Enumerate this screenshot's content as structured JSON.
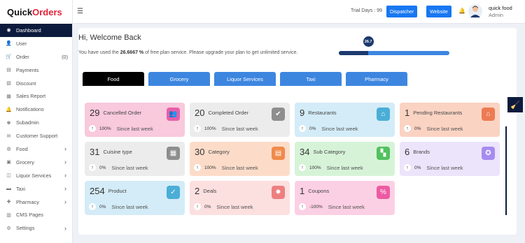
{
  "brand": {
    "part1": "Quick",
    "part2": "Orders"
  },
  "sidebar": {
    "items": [
      {
        "label": "Dashboard",
        "icon": "dashboard-icon",
        "glyph": "◉",
        "active": true
      },
      {
        "label": "User",
        "icon": "user-icon",
        "glyph": "👤"
      },
      {
        "label": "Order",
        "icon": "order-icon",
        "glyph": "🛒",
        "count": "(0)"
      },
      {
        "label": "Payments",
        "icon": "payments-icon",
        "glyph": "▤"
      },
      {
        "label": "Discount",
        "icon": "discount-icon",
        "glyph": "▧"
      },
      {
        "label": "Sales Report",
        "icon": "report-icon",
        "glyph": "▦"
      },
      {
        "label": "Notifications",
        "icon": "bell-icon",
        "glyph": "🔔"
      },
      {
        "label": "Subadmin",
        "icon": "subadmin-icon",
        "glyph": "♚"
      },
      {
        "label": "Customer Support",
        "icon": "support-icon",
        "glyph": "✉"
      },
      {
        "label": "Food",
        "icon": "food-icon",
        "glyph": "◍",
        "chevron": true
      },
      {
        "label": "Grocery",
        "icon": "grocery-icon",
        "glyph": "▣",
        "chevron": true
      },
      {
        "label": "Liquor Services",
        "icon": "liquor-icon",
        "glyph": "◫",
        "chevron": true
      },
      {
        "label": "Taxi",
        "icon": "taxi-icon",
        "glyph": "▬",
        "chevron": true
      },
      {
        "label": "Pharmacy",
        "icon": "pharmacy-icon",
        "glyph": "✚",
        "chevron": true
      },
      {
        "label": "CMS Pages",
        "icon": "cms-icon",
        "glyph": "▥"
      },
      {
        "label": "Settings",
        "icon": "settings-icon",
        "glyph": "⚙",
        "chevron": true
      }
    ]
  },
  "topbar": {
    "trial": "Trial Days : 99",
    "dispatcher": "Dispatcher",
    "website": "Website",
    "user_name": "quick food",
    "user_role": "Admin"
  },
  "main": {
    "welcome": "Hi, Welcome Back",
    "usage_prefix": "You have used the ",
    "usage_value": "26.6667 %",
    "usage_suffix": " of free plan service. Please upgrade your plan to get unlimited service.",
    "progress_badge": "26.7",
    "progress_fraction": 0.267,
    "tabs": [
      "Food",
      "Grocery",
      "Liquor Services",
      "Taxi",
      "Pharmacy"
    ],
    "active_tab": 0,
    "since_text": "Since last week",
    "cards": [
      {
        "count": "29",
        "label": "Cancelled Order",
        "pct": "100%",
        "bg": "#f9c9dc",
        "icon_bg": "#e85fa8",
        "icon": "users-icon",
        "glyph": "👥"
      },
      {
        "count": "20",
        "label": "Completed Order",
        "pct": "100%",
        "bg": "#ececec",
        "icon_bg": "#8e8e8e",
        "icon": "box-check-icon",
        "glyph": "✔"
      },
      {
        "count": "9",
        "label": "Restaurants",
        "pct": "0%",
        "bg": "#d3ecf7",
        "icon_bg": "#4aaed6",
        "icon": "store-icon",
        "glyph": "⌂"
      },
      {
        "count": "1",
        "label": "Pending Restaurants",
        "pct": "0%",
        "bg": "#fbd3c3",
        "icon_bg": "#ec7b53",
        "icon": "shop-icon",
        "glyph": "⌂"
      },
      {
        "count": "31",
        "label": "Cuisine type",
        "pct": "0%",
        "bg": "#ececec",
        "icon_bg": "#8e8e8e",
        "icon": "cuisine-icon",
        "glyph": "▦"
      },
      {
        "count": "30",
        "label": "Category",
        "pct": "100%",
        "bg": "#fcdcc9",
        "icon_bg": "#f08a4a",
        "icon": "category-icon",
        "glyph": "▤"
      },
      {
        "count": "34",
        "label": "Sub Category",
        "pct": "100%",
        "bg": "#d6f3d8",
        "icon_bg": "#52c15e",
        "icon": "grid-icon",
        "glyph": "▚"
      },
      {
        "count": "6",
        "label": "Brands",
        "pct": "0%",
        "bg": "#ece4fb",
        "icon_bg": "#a78bf0",
        "icon": "badge-icon",
        "glyph": "✪"
      },
      {
        "count": "254",
        "label": "Product",
        "pct": "0%",
        "bg": "#d3ecf7",
        "icon_bg": "#4aaed6",
        "icon": "bag-icon",
        "glyph": "✓"
      },
      {
        "count": "2",
        "label": "Deals",
        "pct": "0%",
        "bg": "#fcdfdf",
        "icon_bg": "#ee7f7f",
        "icon": "deals-icon",
        "glyph": "✹"
      },
      {
        "count": "1",
        "label": "Coupons",
        "pct": "-100%",
        "bg": "#fcd0e4",
        "icon_bg": "#ec5ba3",
        "icon": "coupon-icon",
        "glyph": "%"
      }
    ]
  }
}
